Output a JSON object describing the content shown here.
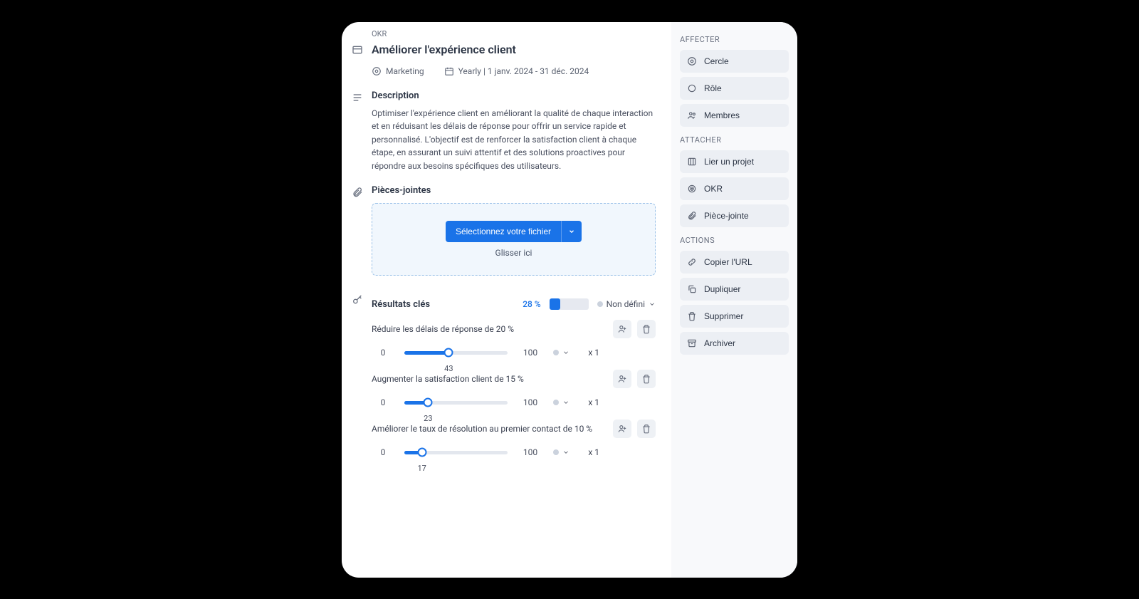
{
  "breadcrumb": "OKR",
  "title": "Améliorer l'expérience client",
  "meta": {
    "circle": "Marketing",
    "period": "Yearly | 1 janv. 2024 - 31 déc. 2024"
  },
  "description": {
    "heading": "Description",
    "text": "Optimiser l'expérience client en améliorant la qualité de chaque interaction et en réduisant les délais de réponse pour offrir un service rapide et personnalisé. L'objectif est de renforcer la satisfaction client à chaque étape, en assurant un suivi attentif et des solutions proactives pour répondre aux besoins spécifiques des utilisateurs."
  },
  "attachments": {
    "heading": "Pièces-jointes",
    "selectFile": "Sélectionnez votre fichier",
    "dragHere": "Glisser ici"
  },
  "keyResults": {
    "heading": "Résultats clés",
    "percent": "28 %",
    "progressFill": 28,
    "status": "Non défini",
    "items": [
      {
        "title": "Réduire les délais de réponse de 20 %",
        "min": "0",
        "max": "100",
        "value": 43,
        "weight": "x 1"
      },
      {
        "title": "Augmenter la satisfaction client de 15 %",
        "min": "0",
        "max": "100",
        "value": 23,
        "weight": "x 1"
      },
      {
        "title": "Améliorer le taux de résolution au premier contact de 10 %",
        "min": "0",
        "max": "100",
        "value": 17,
        "weight": "x 1"
      }
    ]
  },
  "sidebar": {
    "assign": {
      "title": "AFFECTER",
      "items": [
        "Cercle",
        "Rôle",
        "Membres"
      ]
    },
    "attach": {
      "title": "ATTACHER",
      "items": [
        "Lier un projet",
        "OKR",
        "Pièce-jointe"
      ]
    },
    "actions": {
      "title": "ACTIONS",
      "items": [
        "Copier l'URL",
        "Dupliquer",
        "Supprimer",
        "Archiver"
      ]
    }
  }
}
